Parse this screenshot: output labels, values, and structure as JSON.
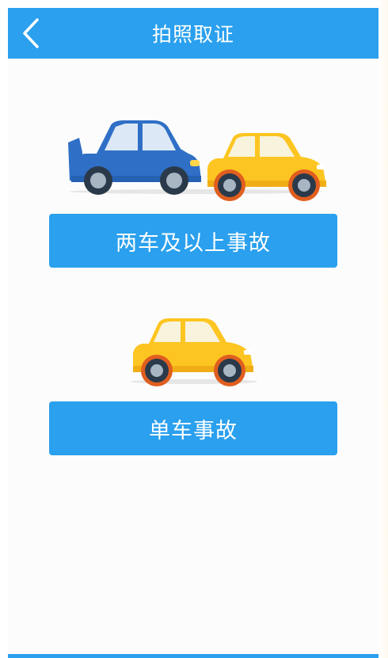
{
  "header": {
    "title": "拍照取证",
    "back_icon": "chevron-left-icon"
  },
  "options": [
    {
      "label": "两车及以上事故",
      "illustration": "two-cars-collision"
    },
    {
      "label": "单车事故",
      "illustration": "single-car"
    }
  ],
  "colors": {
    "accent": "#2aa0ee",
    "blue_car": "#2f6fc6",
    "yellow_car": "#fcc521"
  }
}
